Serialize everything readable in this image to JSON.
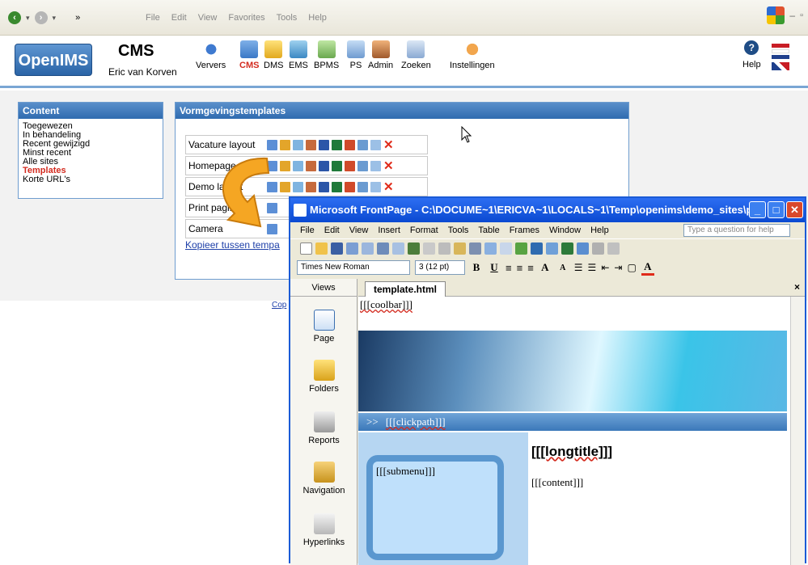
{
  "ie": {
    "menu": [
      "File",
      "Edit",
      "View",
      "Favorites",
      "Tools",
      "Help"
    ],
    "chevron": "»"
  },
  "app": {
    "logo": "OpenIMS",
    "title": "CMS",
    "user": "Eric van Korven",
    "toolbar": [
      "Ververs",
      "CMS",
      "DMS",
      "EMS",
      "BPMS",
      "PS",
      "Admin",
      "Zoeken",
      "Instellingen"
    ],
    "help": "Help"
  },
  "content_panel": {
    "title": "Content",
    "items": [
      "Toegewezen",
      "In behandeling",
      "Recent gewijzigd",
      "Minst recent",
      "Alle sites",
      "Templates",
      "Korte URL's"
    ],
    "active": "Templates"
  },
  "templates_panel": {
    "title": "Vormgevingstemplates",
    "rows": [
      "Vacature layout",
      "Homepage",
      "Demo layout",
      "Print pagina",
      "Camera"
    ],
    "copy_link": "Kopieer tussen tempa",
    "footer_fragment": "Cop"
  },
  "frontpage": {
    "title": "Microsoft FrontPage - C:\\DOCUME~1\\ERICVA~1\\LOCALS~1\\Temp\\openims\\demo_sites\\p...",
    "menu": [
      "File",
      "Edit",
      "View",
      "Insert",
      "Format",
      "Tools",
      "Table",
      "Frames",
      "Window",
      "Help"
    ],
    "ask_placeholder": "Type a question for help",
    "font": "Times New Roman",
    "size": "3 (12 pt)",
    "views_header": "Views",
    "views": [
      "Page",
      "Folders",
      "Reports",
      "Navigation",
      "Hyperlinks"
    ],
    "tab": "template.html",
    "coolbar": "[[[coolbar]]]",
    "clickpath": "[[[clickpath]]]",
    "clickpath_prefix": ">>",
    "submenu": "[[[submenu]]]",
    "longtitle": "[[[longtitle]]]",
    "content": "[[[content]]]"
  },
  "colors": {
    "accent_blue": "#2f6bb0",
    "active_red": "#d32b1f",
    "xp_title": "#0a49d1"
  }
}
